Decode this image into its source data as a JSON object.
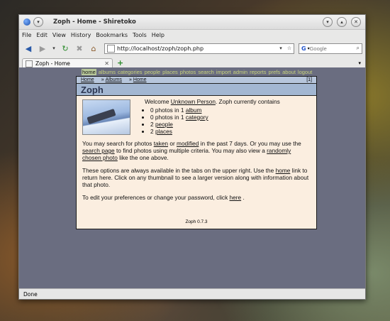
{
  "window": {
    "title": "Zoph - Home - Shiretoko"
  },
  "menu": [
    "File",
    "Edit",
    "View",
    "History",
    "Bookmarks",
    "Tools",
    "Help"
  ],
  "nav": {
    "url": "http://localhost/zoph/zoph.php",
    "search_placeholder": "Google",
    "search_engine": "G"
  },
  "tabs": {
    "active_title": "Zoph - Home"
  },
  "zoph": {
    "tabs": [
      "home",
      "albums",
      "categories",
      "people",
      "places",
      "photos",
      "search",
      "import",
      "admin",
      "reports",
      "prefs",
      "about",
      "logout"
    ],
    "breadcrumb": {
      "home": "Home",
      "sep": "»",
      "albums": "Albums",
      "home2": "Home",
      "count": "[1]"
    },
    "heading": "Zoph",
    "welcome_pre": "Welcome",
    "user_link": "Unknown Person",
    "welcome_post": ". Zoph currently contains",
    "stats": [
      {
        "count": "0 photos in 1",
        "link": "album"
      },
      {
        "count": "0 photos in 1",
        "link": "category"
      },
      {
        "count": "2",
        "link": "people"
      },
      {
        "count": "2",
        "link": "places"
      }
    ],
    "para1": {
      "a": "You may search for photos",
      "taken": "taken",
      "b": "or",
      "modified": "modified",
      "c": "in the past 7 days. Or you may use the",
      "search_page": "search page",
      "d": "to find photos using multiple criteria. You may also view a",
      "random": "randomly chosen photo",
      "e": "like the one above."
    },
    "para2": {
      "a": "These options are always available in the tabs on the upper right. Use the",
      "home": "home",
      "b": "link to return here. Click on any thumbnail to see a larger version along with information about that photo."
    },
    "para3": {
      "a": "To edit your preferences or change your password, click",
      "here": "here",
      "b": "."
    },
    "footer": "Zoph 0.7.3"
  },
  "status": "Done"
}
